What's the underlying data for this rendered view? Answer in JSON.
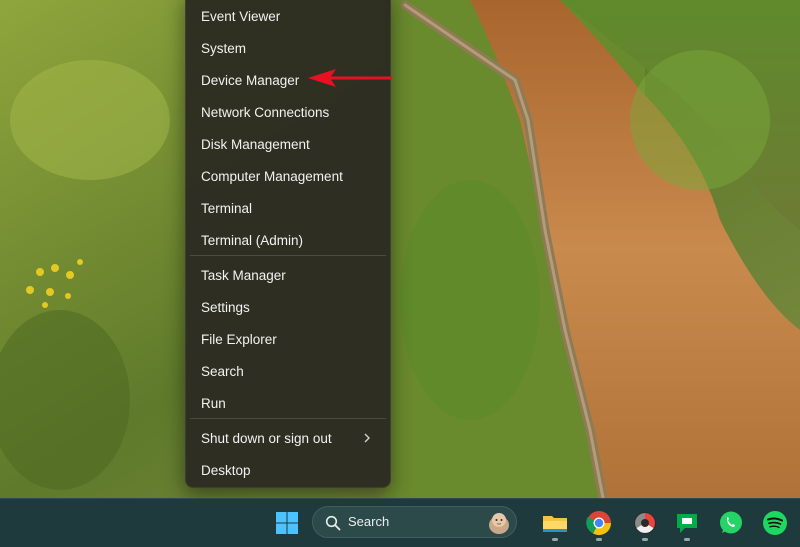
{
  "menu": {
    "items": [
      {
        "label": "Event Viewer"
      },
      {
        "label": "System"
      },
      {
        "label": "Device Manager"
      },
      {
        "label": "Network Connections"
      },
      {
        "label": "Disk Management"
      },
      {
        "label": "Computer Management"
      },
      {
        "label": "Terminal"
      },
      {
        "label": "Terminal (Admin)"
      },
      {
        "label": "Task Manager"
      },
      {
        "label": "Settings"
      },
      {
        "label": "File Explorer"
      },
      {
        "label": "Search"
      },
      {
        "label": "Run"
      },
      {
        "label": "Shut down or sign out"
      },
      {
        "label": "Desktop"
      }
    ]
  },
  "annotation": {
    "color": "#e81123"
  },
  "taskbar": {
    "search_label": "Search",
    "apps": [
      "start-icon",
      "file-explorer-icon",
      "chrome-icon",
      "davinci-resolve-icon",
      "google-chat-icon",
      "whatsapp-icon",
      "spotify-icon"
    ]
  }
}
